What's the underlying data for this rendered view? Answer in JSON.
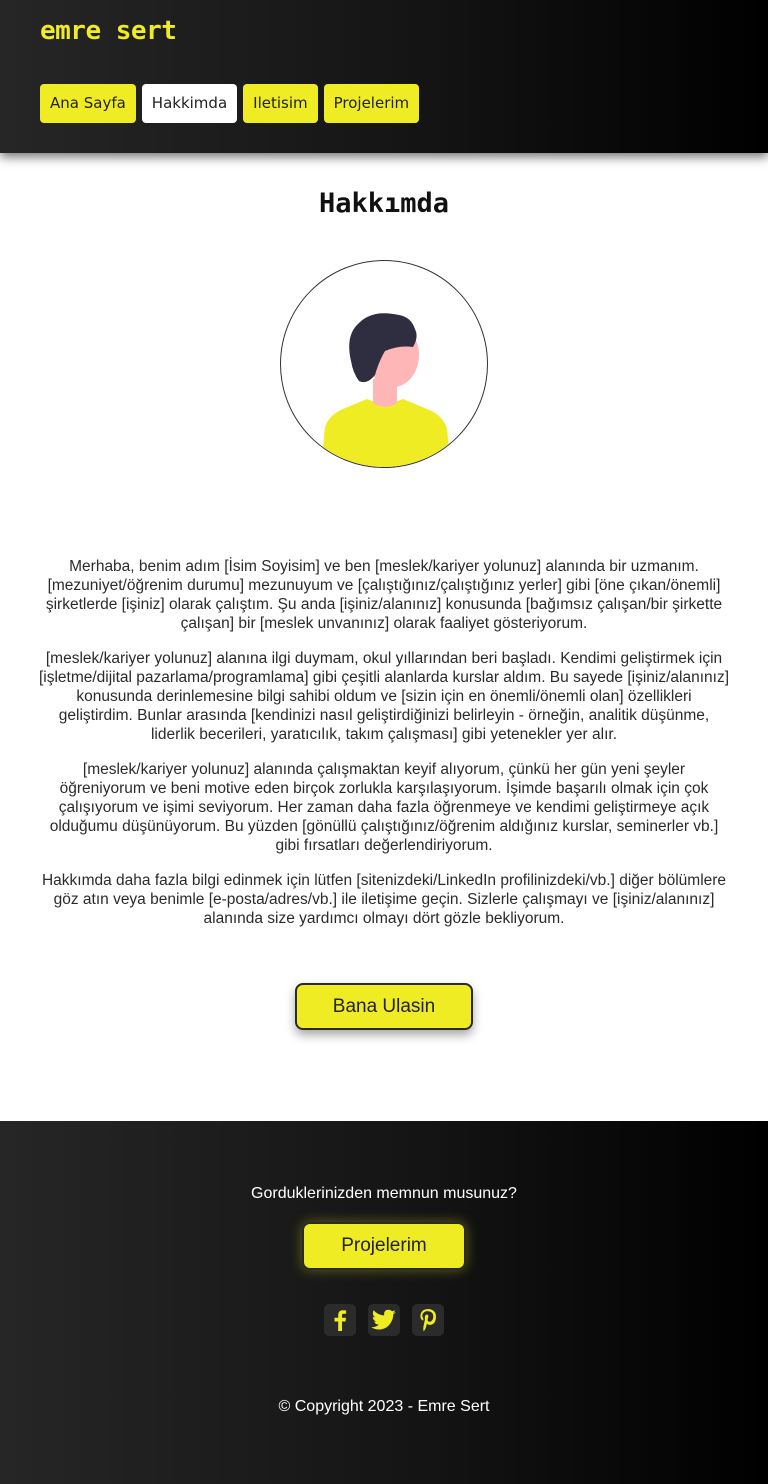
{
  "header": {
    "logo": "emre sert",
    "nav": [
      {
        "label": "Ana Sayfa",
        "active": false
      },
      {
        "label": "Hakkimda",
        "active": true
      },
      {
        "label": "Iletisim",
        "active": false
      },
      {
        "label": "Projelerim",
        "active": false
      }
    ]
  },
  "main": {
    "title": "Hakkımda",
    "avatar_icon": "person-avatar-illustration",
    "paragraphs": [
      "Merhaba, benim adım [İsim Soyisim] ve ben [meslek/kariyer yolunuz] alanında bir uzmanım. [mezuniyet/öğrenim durumu] mezunuyum ve [çalıştığınız/çalıştığınız yerler] gibi [öne çıkan/önemli] şirketlerde [işiniz] olarak çalıştım. Şu anda [işiniz/alanınız] konusunda [bağımsız çalışan/bir şirkette çalışan] bir [meslek unvanınız] olarak faaliyet gösteriyorum.",
      "[meslek/kariyer yolunuz] alanına ilgi duymam, okul yıllarından beri başladı. Kendimi geliştirmek için [işletme/dijital pazarlama/programlama] gibi çeşitli alanlarda kurslar aldım. Bu sayede [işiniz/alanınız] konusunda derinlemesine bilgi sahibi oldum ve [sizin için en önemli/önemli olan] özellikleri geliştirdim. Bunlar arasında [kendinizi nasıl geliştirdiğinizi belirleyin - örneğin, analitik düşünme, liderlik becerileri, yaratıcılık, takım çalışması] gibi yetenekler yer alır.",
      "[meslek/kariyer yolunuz] alanında çalışmaktan keyif alıyorum, çünkü her gün yeni şeyler öğreniyorum ve beni motive eden birçok zorlukla karşılaşıyorum. İşimde başarılı olmak için çok çalışıyorum ve işimi seviyorum. Her zaman daha fazla öğrenmeye ve kendimi geliştirmeye açık olduğumu düşünüyorum. Bu yüzden [gönüllü çalıştığınız/öğrenim aldığınız kurslar, seminerler vb.] gibi fırsatları değerlendiriyorum.",
      "Hakkımda daha fazla bilgi edinmek için lütfen [sitenizdeki/LinkedIn profilinizdeki/vb.] diğer bölümlere göz atın veya benimle [e-posta/adres/vb.] ile iletişime geçin. Sizlerle çalışmayı ve [işiniz/alanınız] alanında size yardımcı olmayı dört gözle bekliyorum."
    ],
    "cta_label": "Bana Ulasin"
  },
  "footer": {
    "question": "Gorduklerinizden memnun musunuz?",
    "button_label": "Projelerim",
    "socials": [
      {
        "icon": "facebook-icon"
      },
      {
        "icon": "twitter-icon"
      },
      {
        "icon": "pinterest-icon"
      }
    ],
    "copyright": "© Copyright 2023 - Emre Sert"
  },
  "colors": {
    "accent": "#f0ec24",
    "header_dark": "#262626",
    "skin": "#ffb6b6",
    "hair": "#2f2e41"
  }
}
